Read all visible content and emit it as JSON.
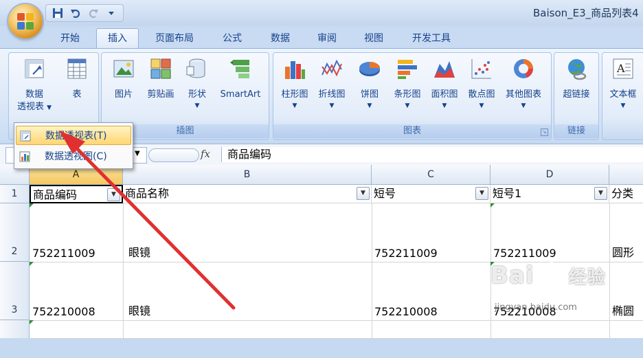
{
  "window": {
    "title": "Baison_E3_商品列表4"
  },
  "quick_access": {
    "icons": [
      "save-icon",
      "undo-icon",
      "redo-icon",
      "customize-icon"
    ]
  },
  "tabs": [
    {
      "label": "开始",
      "active": false
    },
    {
      "label": "插入",
      "active": true
    },
    {
      "label": "页面布局",
      "active": false
    },
    {
      "label": "公式",
      "active": false
    },
    {
      "label": "数据",
      "active": false
    },
    {
      "label": "审阅",
      "active": false
    },
    {
      "label": "视图",
      "active": false
    },
    {
      "label": "开发工具",
      "active": false
    }
  ],
  "ribbon": {
    "table_group": {
      "pivot_line1": "数据",
      "pivot_line2": "透视表",
      "table": "表"
    },
    "illustrations": {
      "label": "插图",
      "picture": "图片",
      "clipart": "剪贴画",
      "shapes": "形状",
      "smartart": "SmartArt"
    },
    "charts": {
      "label": "图表",
      "column": "柱形图",
      "line": "折线图",
      "pie": "饼图",
      "bar": "条形图",
      "area": "面积图",
      "scatter": "散点图",
      "other": "其他图表"
    },
    "links": {
      "label": "链接",
      "hyperlink": "超链接"
    },
    "text": {
      "textbox": "文本框"
    }
  },
  "pivot_menu": {
    "items": [
      "数据透视表(T)",
      "数据透视图(C)"
    ]
  },
  "formula_bar": {
    "fx": "fx",
    "content": "商品编码"
  },
  "sheet": {
    "columns": [
      "A",
      "B",
      "C",
      "D"
    ],
    "rows": [
      "1",
      "2",
      "3"
    ],
    "headers": [
      "商品编码",
      "商品名称",
      "短号",
      "短号1",
      "分类"
    ],
    "data": [
      [
        "752211009",
        "眼镜",
        "752211009",
        "752211009",
        "圆形"
      ],
      [
        "752210008",
        "眼镜",
        "752210008",
        "752210008",
        "椭圆"
      ]
    ]
  },
  "watermark": {
    "main": "Bai",
    "mid": "经验",
    "sub": "jingyan.baidu.com"
  }
}
